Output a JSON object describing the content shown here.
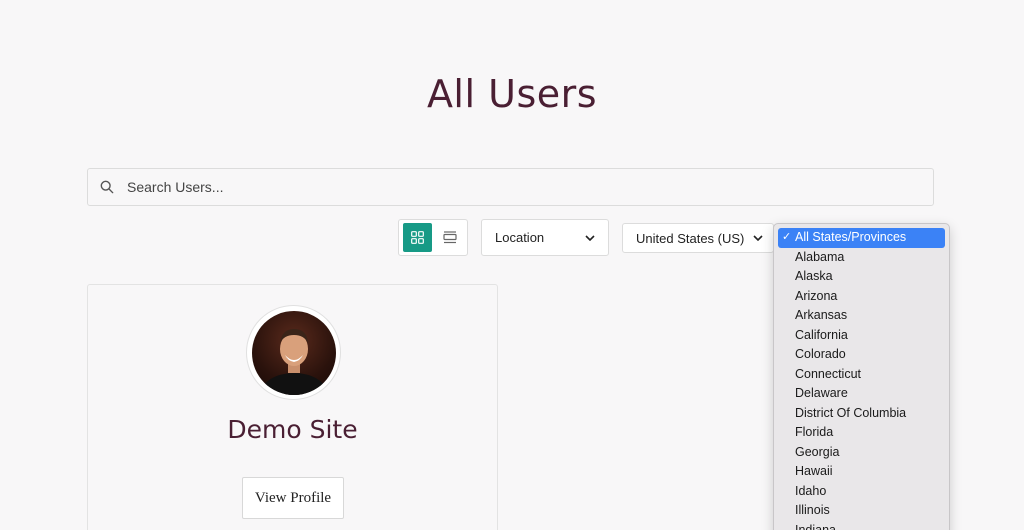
{
  "page": {
    "title": "All Users"
  },
  "search": {
    "placeholder": "Search Users..."
  },
  "filters": {
    "location_label": "Location",
    "country_label": "United States (US)"
  },
  "colors": {
    "accent": "#179a86",
    "title": "#4a1f33",
    "selected": "#3b82f6"
  },
  "users": [
    {
      "name": "Demo Site",
      "button_label": "View Profile"
    }
  ],
  "states_dropdown": {
    "selected": "All States/Provinces",
    "options": [
      "All States/Provinces",
      "Alabama",
      "Alaska",
      "Arizona",
      "Arkansas",
      "California",
      "Colorado",
      "Connecticut",
      "Delaware",
      "District Of Columbia",
      "Florida",
      "Georgia",
      "Hawaii",
      "Idaho",
      "Illinois",
      "Indiana"
    ]
  }
}
